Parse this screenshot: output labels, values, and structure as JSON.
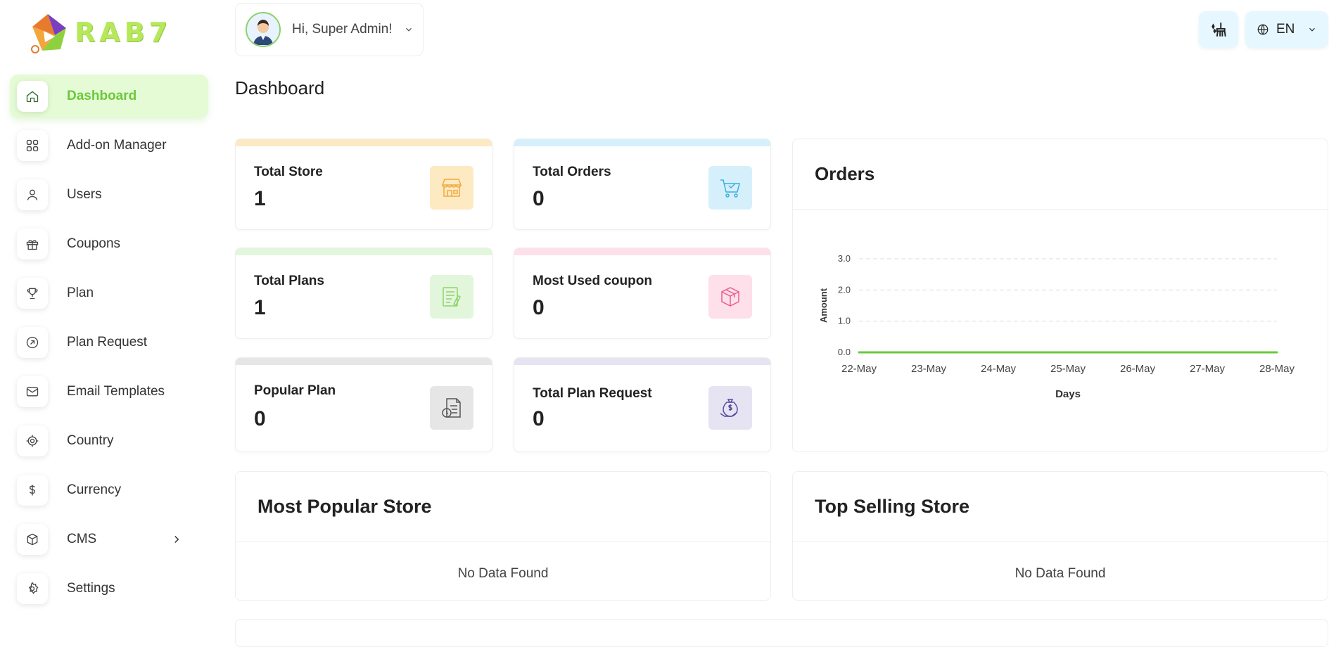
{
  "brand": {
    "name": "RAB7"
  },
  "sidebar": {
    "items": [
      {
        "label": "Dashboard",
        "icon": "home-icon",
        "active": true
      },
      {
        "label": "Add-on Manager",
        "icon": "grid-icon"
      },
      {
        "label": "Users",
        "icon": "user-icon"
      },
      {
        "label": "Coupons",
        "icon": "gift-icon"
      },
      {
        "label": "Plan",
        "icon": "trophy-icon"
      },
      {
        "label": "Plan Request",
        "icon": "arrow-circle-icon"
      },
      {
        "label": "Email Templates",
        "icon": "mail-icon"
      },
      {
        "label": "Country",
        "icon": "target-icon"
      },
      {
        "label": "Currency",
        "icon": "dollar-icon"
      },
      {
        "label": "CMS",
        "icon": "box-icon",
        "has_submenu": true
      },
      {
        "label": "Settings",
        "icon": "gear-icon"
      }
    ]
  },
  "header": {
    "greeting": "Hi, Super Admin!",
    "language": "EN"
  },
  "page": {
    "title": "Dashboard"
  },
  "stats": [
    {
      "label": "Total Store",
      "value": "1",
      "color": "#fde9c2",
      "icon": "store-icon"
    },
    {
      "label": "Total Orders",
      "value": "0",
      "color": "#d5f0fb",
      "icon": "cart-icon"
    },
    {
      "label": "Total Plans",
      "value": "1",
      "color": "#e2f6dc",
      "icon": "plan-list-icon"
    },
    {
      "label": "Most Used coupon",
      "value": "0",
      "color": "#fde0ea",
      "icon": "package-icon"
    },
    {
      "label": "Popular Plan",
      "value": "0",
      "color": "#e6e6e6",
      "icon": "document-clock-icon"
    },
    {
      "label": "Total Plan Request",
      "value": "0",
      "color": "#e6e3f2",
      "icon": "money-hand-icon"
    }
  ],
  "orders_panel": {
    "title": "Orders"
  },
  "chart_data": {
    "type": "line",
    "categories": [
      "22-May",
      "23-May",
      "24-May",
      "25-May",
      "26-May",
      "27-May",
      "28-May"
    ],
    "series": [
      {
        "values": [
          0,
          0,
          0,
          0,
          0,
          0,
          0
        ],
        "color": "#6cc83a"
      }
    ],
    "yticks": [
      "0.0",
      "1.0",
      "2.0",
      "3.0"
    ],
    "ylim": [
      0,
      3
    ],
    "xlabel": "Days",
    "ylabel": "Amount",
    "grid": true
  },
  "popular_store": {
    "title": "Most Popular Store",
    "empty": "No Data Found"
  },
  "top_selling_store": {
    "title": "Top Selling Store",
    "empty": "No Data Found"
  }
}
